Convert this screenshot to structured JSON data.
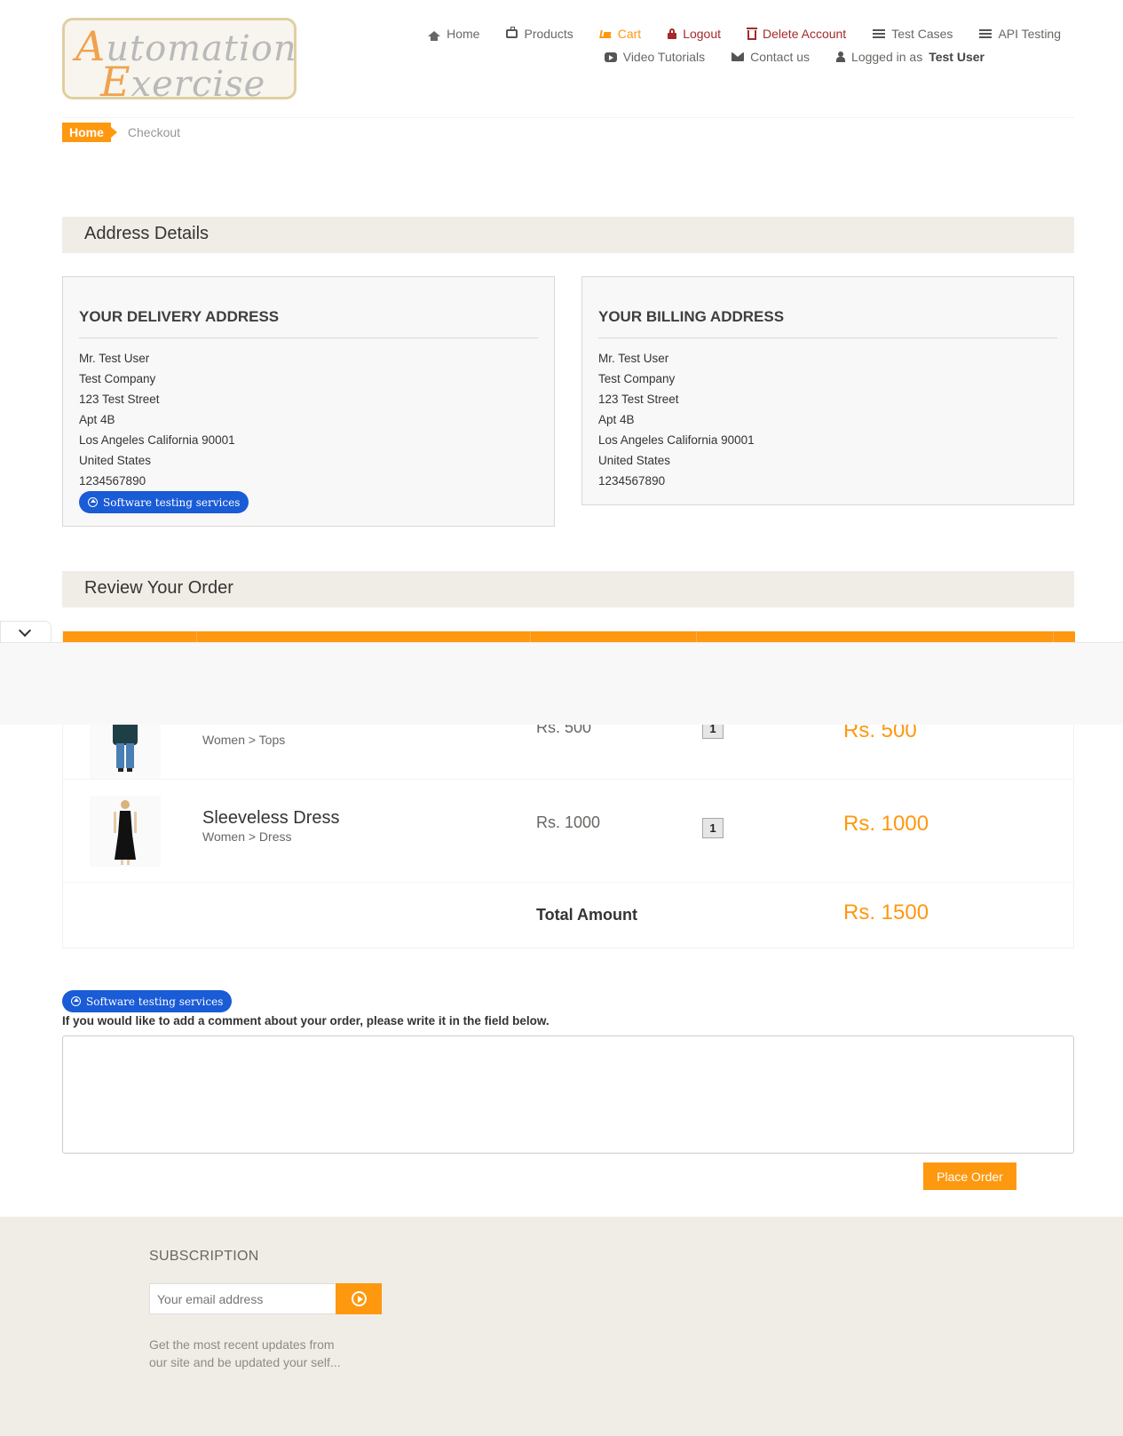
{
  "logo": {
    "line1_cap": "A",
    "line1_rest": "utomation",
    "line2_cap": "E",
    "line2_rest": "xercise"
  },
  "nav": {
    "row1": [
      {
        "label": "Home",
        "icon": "home-icon"
      },
      {
        "label": "Products",
        "icon": "briefcase-icon"
      },
      {
        "label": "Cart",
        "icon": "cart-icon"
      },
      {
        "label": "Logout",
        "icon": "lock-icon"
      },
      {
        "label": "Delete Account",
        "icon": "trash-icon"
      },
      {
        "label": "Test Cases",
        "icon": "list-icon"
      },
      {
        "label": "API Testing",
        "icon": "list-icon"
      }
    ],
    "row2": [
      {
        "label": "Video Tutorials",
        "icon": "youtube-icon"
      },
      {
        "label": "Contact us",
        "icon": "envelope-icon"
      }
    ],
    "logged_in_prefix": "Logged in as",
    "logged_in_user": "Test User"
  },
  "breadcrumb": {
    "home": "Home",
    "current": "Checkout"
  },
  "address_section": {
    "title": "Address Details"
  },
  "delivery": {
    "title": "YOUR DELIVERY ADDRESS",
    "lines": [
      "Mr. Test User",
      "Test Company",
      "123 Test Street",
      "Apt 4B",
      "Los Angeles California 90001",
      "United States",
      "1234567890"
    ]
  },
  "billing": {
    "title": "YOUR BILLING ADDRESS",
    "lines": [
      "Mr. Test User",
      "Test Company",
      "123 Test Street",
      "Apt 4B",
      "Los Angeles California 90001",
      "United States",
      "1234567890"
    ]
  },
  "ad_pill": {
    "label": "Software testing services"
  },
  "review_section": {
    "title": "Review Your Order"
  },
  "order": {
    "items": [
      {
        "name": "",
        "category": "Women > Tops",
        "price": "Rs. 500",
        "quantity": "1",
        "total": "Rs. 500"
      },
      {
        "name": "Sleeveless Dress",
        "category": "Women > Dress",
        "price": "Rs. 1000",
        "quantity": "1",
        "total": "Rs. 1000"
      }
    ],
    "total_label": "Total Amount",
    "total_value": "Rs. 1500"
  },
  "comment": {
    "label": "If you would like to add a comment about your order, please write it in the field below.",
    "value": ""
  },
  "place_order": {
    "label": "Place Order"
  },
  "footer": {
    "subscription_title": "SUBSCRIPTION",
    "email_placeholder": "Your email address",
    "subscription_text": "Get the most recent updates from our site and be updated your self..."
  },
  "colors": {
    "accent": "#FE980F",
    "danger": "#a52a2a",
    "section_bg": "#efede6",
    "ad_blue": "#1a5bd6"
  }
}
